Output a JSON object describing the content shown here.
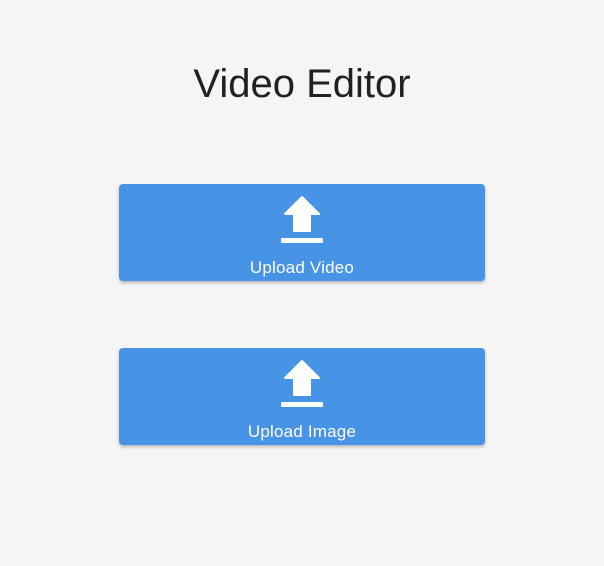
{
  "header": {
    "title": "Video Editor"
  },
  "buttons": [
    {
      "label": "Upload Video",
      "icon": "upload-icon"
    },
    {
      "label": "Upload Image",
      "icon": "upload-icon"
    }
  ],
  "colors": {
    "background": "#f5f5f5",
    "button": "#4793e6",
    "button_text": "#ffffff",
    "title_text": "#212121"
  }
}
